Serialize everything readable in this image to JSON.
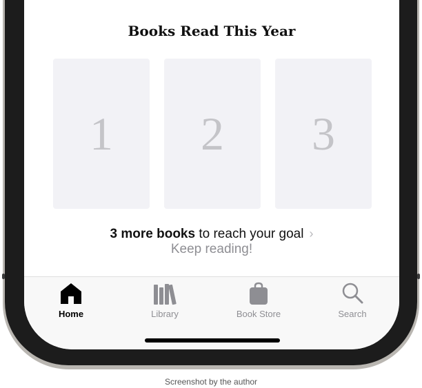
{
  "section": {
    "title": "Books Read This Year",
    "slots": [
      "1",
      "2",
      "3"
    ]
  },
  "goal": {
    "count_text": "3 more books",
    "rest_text": " to reach your goal",
    "chevron": "chevron-right-icon",
    "subtext": "Keep reading!"
  },
  "tabbar": {
    "tabs": [
      {
        "label": "Home",
        "icon": "home-icon",
        "active": true
      },
      {
        "label": "Library",
        "icon": "library-icon",
        "active": false
      },
      {
        "label": "Book Store",
        "icon": "shopping-bag-icon",
        "active": false
      },
      {
        "label": "Search",
        "icon": "search-icon",
        "active": false
      }
    ]
  },
  "caption": "Screenshot by the author",
  "colors": {
    "active_tab": "#000000",
    "inactive_tab": "#8e8e93",
    "slot_bg": "#f2f2f6",
    "slot_number": "#c4c4c8",
    "frame": "#1c1c1c"
  }
}
